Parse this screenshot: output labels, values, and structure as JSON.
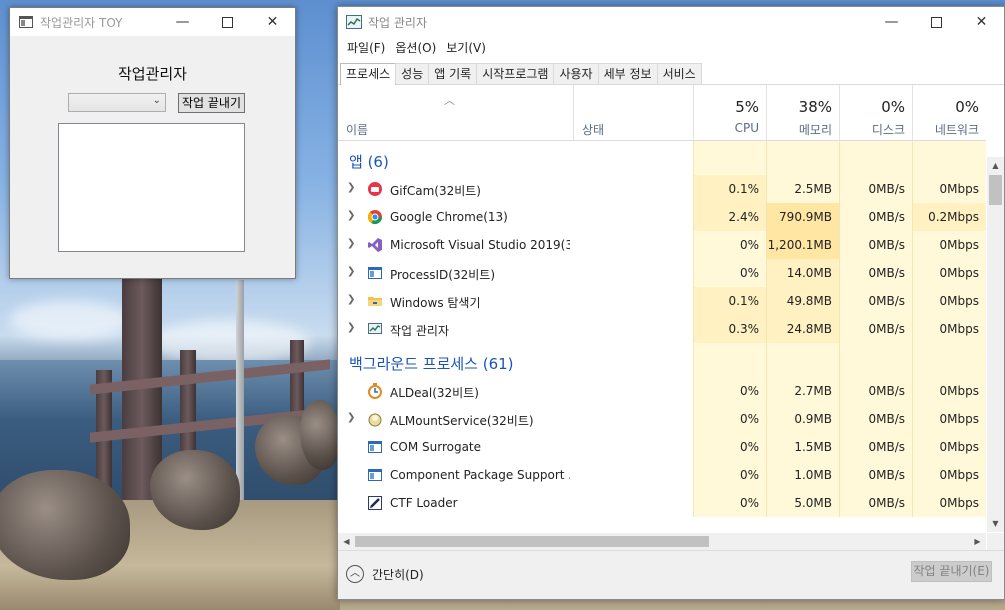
{
  "toy_window": {
    "title": "작업관리자 TOY",
    "heading": "작업관리자",
    "select_value": "",
    "end_button": "작업 끝내기"
  },
  "taskmgr": {
    "title": "작업 관리자",
    "menu": [
      "파일(F)",
      "옵션(O)",
      "보기(V)"
    ],
    "tabs": [
      "프로세스",
      "성능",
      "앱 기록",
      "시작프로그램",
      "사용자",
      "세부 정보",
      "서비스"
    ],
    "active_tab": "프로세스",
    "columns": {
      "name": "이름",
      "status": "상태",
      "cpu": {
        "pct": "5%",
        "label": "CPU"
      },
      "memory": {
        "pct": "38%",
        "label": "메모리"
      },
      "disk": {
        "pct": "0%",
        "label": "디스크"
      },
      "network": {
        "pct": "0%",
        "label": "네트워크"
      }
    },
    "groups": [
      {
        "title": "앱 (6)",
        "rows": [
          {
            "name": "GifCam(32비트)",
            "icon": "gifcam-icon",
            "expandable": true,
            "cpu": "0.1%",
            "mem": "2.5MB",
            "disk": "0MB/s",
            "net": "0Mbps"
          },
          {
            "name": "Google Chrome(13)",
            "icon": "chrome-icon",
            "expandable": true,
            "cpu": "2.4%",
            "mem": "790.9MB",
            "disk": "0MB/s",
            "net": "0.2Mbps"
          },
          {
            "name": "Microsoft Visual Studio 2019(3...",
            "icon": "visual-studio-icon",
            "expandable": true,
            "cpu": "0%",
            "mem": "1,200.1MB",
            "disk": "0MB/s",
            "net": "0Mbps"
          },
          {
            "name": "ProcessID(32비트)",
            "icon": "window-app-icon",
            "expandable": true,
            "cpu": "0%",
            "mem": "14.0MB",
            "disk": "0MB/s",
            "net": "0Mbps"
          },
          {
            "name": "Windows 탐색기",
            "icon": "folder-icon",
            "expandable": true,
            "cpu": "0.1%",
            "mem": "49.8MB",
            "disk": "0MB/s",
            "net": "0Mbps"
          },
          {
            "name": "작업 관리자",
            "icon": "task-manager-icon",
            "expandable": true,
            "cpu": "0.3%",
            "mem": "24.8MB",
            "disk": "0MB/s",
            "net": "0Mbps"
          }
        ]
      },
      {
        "title": "백그라운드 프로세스 (61)",
        "rows": [
          {
            "name": "ALDeal(32비트)",
            "icon": "aldeal-icon",
            "expandable": false,
            "cpu": "0%",
            "mem": "2.7MB",
            "disk": "0MB/s",
            "net": "0Mbps"
          },
          {
            "name": "ALMountService(32비트)",
            "icon": "almount-icon",
            "expandable": true,
            "cpu": "0%",
            "mem": "0.9MB",
            "disk": "0MB/s",
            "net": "0Mbps"
          },
          {
            "name": "COM Surrogate",
            "icon": "window-app-icon",
            "expandable": false,
            "cpu": "0%",
            "mem": "1.5MB",
            "disk": "0MB/s",
            "net": "0Mbps"
          },
          {
            "name": "Component Package Support ...",
            "icon": "window-app-icon",
            "expandable": false,
            "cpu": "0%",
            "mem": "1.0MB",
            "disk": "0MB/s",
            "net": "0Mbps"
          },
          {
            "name": "CTF Loader",
            "icon": "ctf-loader-icon",
            "expandable": false,
            "cpu": "0%",
            "mem": "5.0MB",
            "disk": "0MB/s",
            "net": "0Mbps"
          }
        ]
      }
    ],
    "footer": {
      "brief_label": "간단히(D)",
      "end_task": "작업 끝내기(E)"
    }
  },
  "colors": {
    "group_title": "#1a56b8",
    "cell_light": "#fff8d9",
    "cell_mid": "#fff1c2",
    "cell_dark": "#ffe6a3"
  }
}
